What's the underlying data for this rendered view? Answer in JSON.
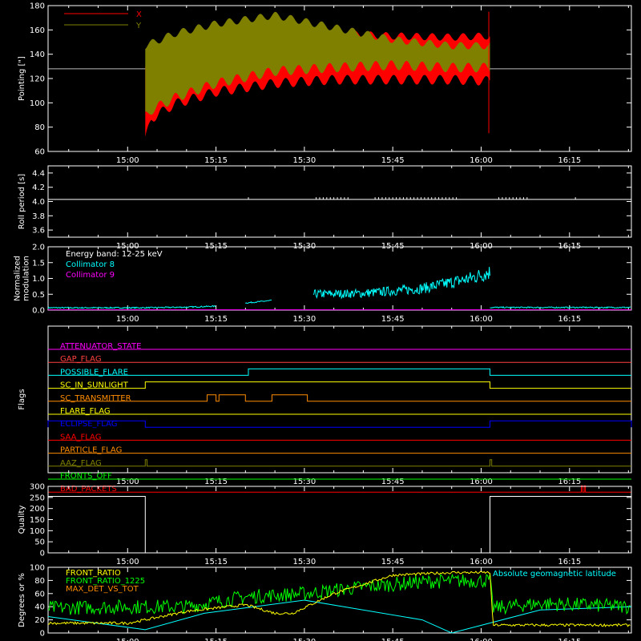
{
  "time_axis": {
    "tick_labels": [
      "15:00",
      "15:15",
      "15:30",
      "15:45",
      "16:00",
      "16:15"
    ],
    "tick_minutes": [
      0,
      15,
      30,
      45,
      60,
      75
    ],
    "range_minutes": [
      -13.5,
      85.5
    ]
  },
  "chart_data": [
    {
      "id": "pointing",
      "type": "line",
      "ylabel": "Pointing [\"]",
      "ylim": [
        60,
        180
      ],
      "yticks": [
        60,
        80,
        100,
        120,
        140,
        160,
        180
      ],
      "reference_line": 128,
      "data_window_minutes": [
        3,
        61.5
      ],
      "series": [
        {
          "name": "X",
          "color": "#ff0000",
          "x": [
            3,
            4,
            8,
            15,
            25,
            35,
            45,
            55,
            61
          ],
          "upper": [
            135,
            148,
            153,
            160,
            162,
            160,
            158,
            157,
            158
          ],
          "lower": [
            65,
            83,
            95,
            105,
            112,
            115,
            115,
            115,
            114
          ]
        },
        {
          "name": "Y",
          "color": "#808000",
          "x": [
            3,
            4,
            8,
            15,
            25,
            35,
            45,
            55,
            61
          ],
          "upper": [
            150,
            152,
            160,
            168,
            175,
            165,
            155,
            150,
            150
          ],
          "lower": [
            85,
            90,
            100,
            112,
            122,
            125,
            127,
            125,
            125
          ]
        }
      ],
      "spike_minute": 61.3,
      "spike_range": [
        75,
        175
      ]
    },
    {
      "id": "roll",
      "type": "line",
      "ylabel": "Roll period [s]",
      "ylim": [
        3.5,
        4.5
      ],
      "yticks": [
        3.6,
        3.8,
        4.0,
        4.2,
        4.4
      ],
      "series": [
        {
          "name": "",
          "color": "#ffffff",
          "value": 4.03
        }
      ]
    },
    {
      "id": "modulation",
      "type": "line",
      "ylabel": [
        "Normalized",
        "modulation"
      ],
      "ylim": [
        0,
        2.0
      ],
      "yticks": [
        0.0,
        0.5,
        1.0,
        1.5,
        2.0
      ],
      "annotation": "Energy band: 12-25 keV",
      "series": [
        {
          "name": "Collimator 8",
          "color": "#00ffff",
          "segments": [
            {
              "x": [
                -13.5,
                3,
                10,
                15
              ],
              "y": [
                0.07,
                0.07,
                0.09,
                0.12
              ]
            },
            {
              "x": [
                20,
                24.5
              ],
              "y": [
                0.22,
                0.3
              ]
            },
            {
              "x": [
                31.5,
                40,
                50,
                58,
                61.5
              ],
              "y": [
                0.48,
                0.5,
                0.65,
                0.95,
                1.15
              ]
            },
            {
              "x": [
                61.5,
                85.5
              ],
              "y": [
                0.08,
                0.08
              ]
            }
          ]
        },
        {
          "name": "Collimator 9",
          "color": "#ff00ff",
          "value": 0.01
        }
      ]
    },
    {
      "id": "flags",
      "type": "table",
      "ylabel": "Flags",
      "rows": [
        {
          "name": "ATTENUATOR_STATE",
          "color": "#ff00ff",
          "steps": [],
          "label_color": "#ff00ff"
        },
        {
          "name": "GAP_FLAG",
          "color": "#ff4040",
          "steps": [],
          "label_color": "#ff4040"
        },
        {
          "name": "POSSIBLE_FLARE",
          "color": "#00ffff",
          "steps": [
            [
              20.5,
              61.5
            ]
          ],
          "label_color": "#00ffff"
        },
        {
          "name": "SC_IN_SUNLIGHT",
          "color": "#ffff00",
          "steps": [
            [
              3,
              61.5
            ]
          ],
          "label_color": "#ffff00"
        },
        {
          "name": "SC_TRANSMITTER",
          "color": "#ff8c00",
          "steps": [
            [
              13.5,
              15
            ],
            [
              15.5,
              20
            ],
            [
              24.5,
              30.5
            ]
          ],
          "label_color": "#ff8c00"
        },
        {
          "name": "FLARE_FLAG",
          "color": "#ffff00",
          "steps": [],
          "label_color": "#ffff00"
        },
        {
          "name": "ECLIPSE_FLAG",
          "color": "#0000ff",
          "steps": [
            [
              -13.5,
              3
            ],
            [
              61.5,
              85.5
            ]
          ],
          "label_color": "#0000ff"
        },
        {
          "name": "SAA_FLAG",
          "color": "#ff0000",
          "steps": [],
          "label_color": "#ff0000"
        },
        {
          "name": "PARTICLE_FLAG",
          "color": "#ff8c00",
          "steps": [],
          "label_color": "#ff8c00"
        },
        {
          "name": "AAZ_FLAG",
          "color": "#808000",
          "steps": [
            [
              3,
              3.3
            ],
            [
              61.5,
              61.8
            ]
          ],
          "label_color": "#808000"
        },
        {
          "name": "FRONTS_OFF",
          "color": "#00ff00",
          "steps": [],
          "label_color": "#00ff00"
        },
        {
          "name": "BAD_PACKETS",
          "color": "#ff0000",
          "steps": [
            [
              77,
              77.2
            ],
            [
              77.5,
              77.7
            ]
          ],
          "label_color": "#ff0000"
        }
      ]
    },
    {
      "id": "quality",
      "type": "line",
      "ylabel": "Quality",
      "ylim": [
        0,
        300
      ],
      "yticks": [
        0,
        50,
        100,
        150,
        200,
        250,
        300
      ],
      "series": [
        {
          "name": "",
          "color": "#ffffff",
          "x": [
            -13.5,
            3,
            3,
            61.5,
            61.5,
            85.5
          ],
          "y": [
            255,
            255,
            0,
            0,
            255,
            255
          ]
        }
      ]
    },
    {
      "id": "front_ratio",
      "type": "line",
      "ylabel": "Degrees or %",
      "ylim": [
        0,
        100
      ],
      "yticks": [
        0,
        20,
        40,
        60,
        80,
        100
      ],
      "series": [
        {
          "name": "FRONT_RATIO",
          "color": "#ffff00",
          "x": [
            -13.5,
            0,
            3,
            10,
            20,
            25,
            28,
            35,
            45,
            55,
            61.5,
            62,
            85.5
          ],
          "y": [
            15,
            15,
            20,
            33,
            43,
            30,
            30,
            60,
            88,
            92,
            92,
            12,
            12
          ]
        },
        {
          "name": "FRONT_RATIO_1225",
          "color": "#00ff00",
          "x": [
            -13.5,
            0,
            10,
            20,
            30,
            40,
            50,
            61.5,
            62,
            70,
            85.5
          ],
          "y": [
            38,
            40,
            40,
            55,
            60,
            70,
            78,
            80,
            38,
            45,
            40
          ]
        },
        {
          "name": "MAX_DET_VS_TOT",
          "color": "#ff8c00",
          "x": [],
          "y": []
        },
        {
          "name": "Absolute geomagnetic latitude",
          "color": "#00ffff",
          "x": [
            -13.5,
            3,
            13,
            30,
            50,
            55,
            70,
            85.5
          ],
          "y": [
            25,
            5,
            30,
            50,
            20,
            0,
            35,
            40
          ]
        }
      ]
    }
  ]
}
